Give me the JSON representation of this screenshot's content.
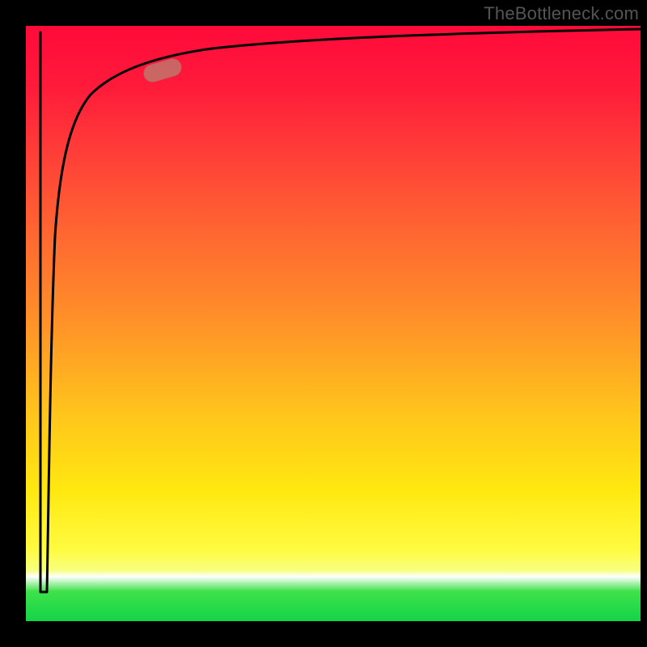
{
  "watermark": "TheBottleneck.com",
  "colors": {
    "curve_stroke": "#000000",
    "marker_fill": "rgba(190,120,110,0.82)"
  },
  "chart_data": {
    "type": "line",
    "title": "",
    "xlabel": "",
    "ylabel": "",
    "xlim": [
      0,
      100
    ],
    "ylim": [
      0,
      100
    ],
    "x": [
      0.5,
      2,
      4,
      5,
      6,
      8,
      10,
      14,
      20,
      30,
      40,
      50,
      60,
      75,
      90,
      100
    ],
    "values": [
      5,
      5,
      20,
      50,
      70,
      80,
      85,
      88,
      91,
      94,
      95.5,
      96.5,
      97.2,
      98,
      98.6,
      99
    ],
    "marker": {
      "x": 20,
      "y": 91
    },
    "gradient_stops": [
      {
        "pos": 0,
        "color": "#ff0a3a"
      },
      {
        "pos": 22,
        "color": "#ff4038"
      },
      {
        "pos": 50,
        "color": "#ff9228"
      },
      {
        "pos": 78,
        "color": "#ffe810"
      },
      {
        "pos": 92.5,
        "color": "#ffffff"
      },
      {
        "pos": 100,
        "color": "#12d448"
      }
    ]
  }
}
